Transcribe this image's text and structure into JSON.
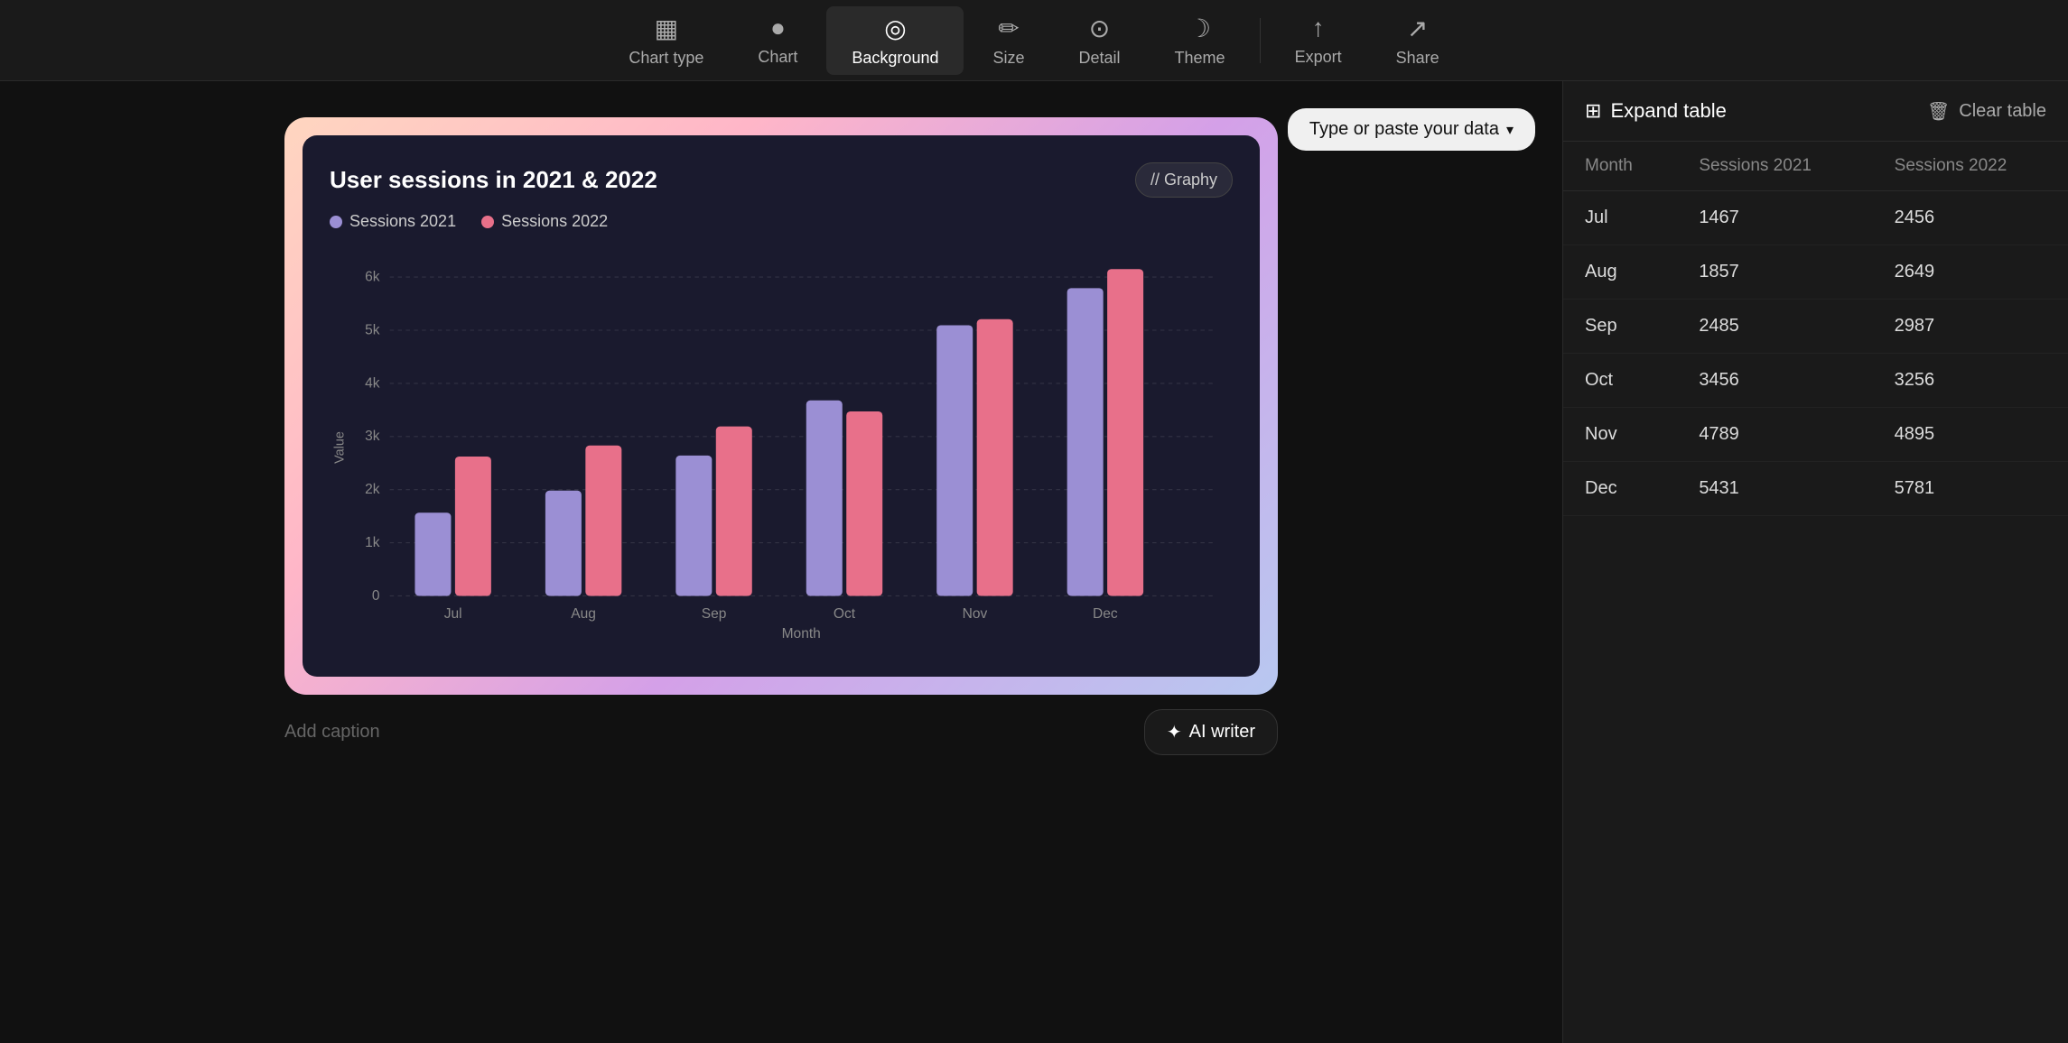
{
  "toolbar": {
    "items": [
      {
        "id": "chart-type",
        "label": "Chart type",
        "icon": "▦",
        "active": false
      },
      {
        "id": "chart",
        "label": "Chart",
        "icon": "●",
        "active": false
      },
      {
        "id": "background",
        "label": "Background",
        "icon": "◎",
        "active": true
      },
      {
        "id": "size",
        "label": "Size",
        "icon": "✏",
        "active": false
      },
      {
        "id": "detail",
        "label": "Detail",
        "icon": "⊙",
        "active": false
      },
      {
        "id": "theme",
        "label": "Theme",
        "icon": "☽",
        "active": false
      }
    ],
    "right_items": [
      {
        "id": "export",
        "label": "Export",
        "icon": "↑"
      },
      {
        "id": "share",
        "label": "Share",
        "icon": "↗"
      }
    ]
  },
  "type_paste_btn": "Type or paste your data",
  "chart": {
    "title": "User sessions in 2021 & 2022",
    "logo": "// Graphy",
    "legend": [
      {
        "id": "sessions2021",
        "label": "Sessions 2021",
        "color": "purple"
      },
      {
        "id": "sessions2022",
        "label": "Sessions 2022",
        "color": "pink"
      }
    ],
    "months": [
      "Jul",
      "Aug",
      "Sep",
      "Oct",
      "Nov",
      "Dec"
    ],
    "sessions2021": [
      1467,
      1857,
      2485,
      3456,
      4789,
      5431
    ],
    "sessions2022": [
      2456,
      2649,
      2987,
      3256,
      4895,
      5781
    ],
    "y_max": 6000,
    "y_labels": [
      "6k",
      "5k",
      "4k",
      "3k",
      "2k",
      "1k",
      "0"
    ],
    "x_axis_label": "Month",
    "y_axis_label": "Value"
  },
  "caption": {
    "placeholder": "Add caption",
    "ai_writer_label": "AI writer",
    "ai_icon": "✦"
  },
  "panel": {
    "expand_label": "Expand table",
    "clear_label": "Clear table",
    "expand_icon": "⊞",
    "clear_icon": "🗑",
    "columns": [
      "Month",
      "Sessions 2021",
      "Sessions 2022"
    ],
    "rows": [
      {
        "month": "Jul",
        "s2021": "1467",
        "s2022": "2456"
      },
      {
        "month": "Aug",
        "s2021": "1857",
        "s2022": "2649"
      },
      {
        "month": "Sep",
        "s2021": "2485",
        "s2022": "2987"
      },
      {
        "month": "Oct",
        "s2021": "3456",
        "s2022": "3256"
      },
      {
        "month": "Nov",
        "s2021": "4789",
        "s2022": "4895"
      },
      {
        "month": "Dec",
        "s2021": "5431",
        "s2022": "5781"
      }
    ]
  }
}
